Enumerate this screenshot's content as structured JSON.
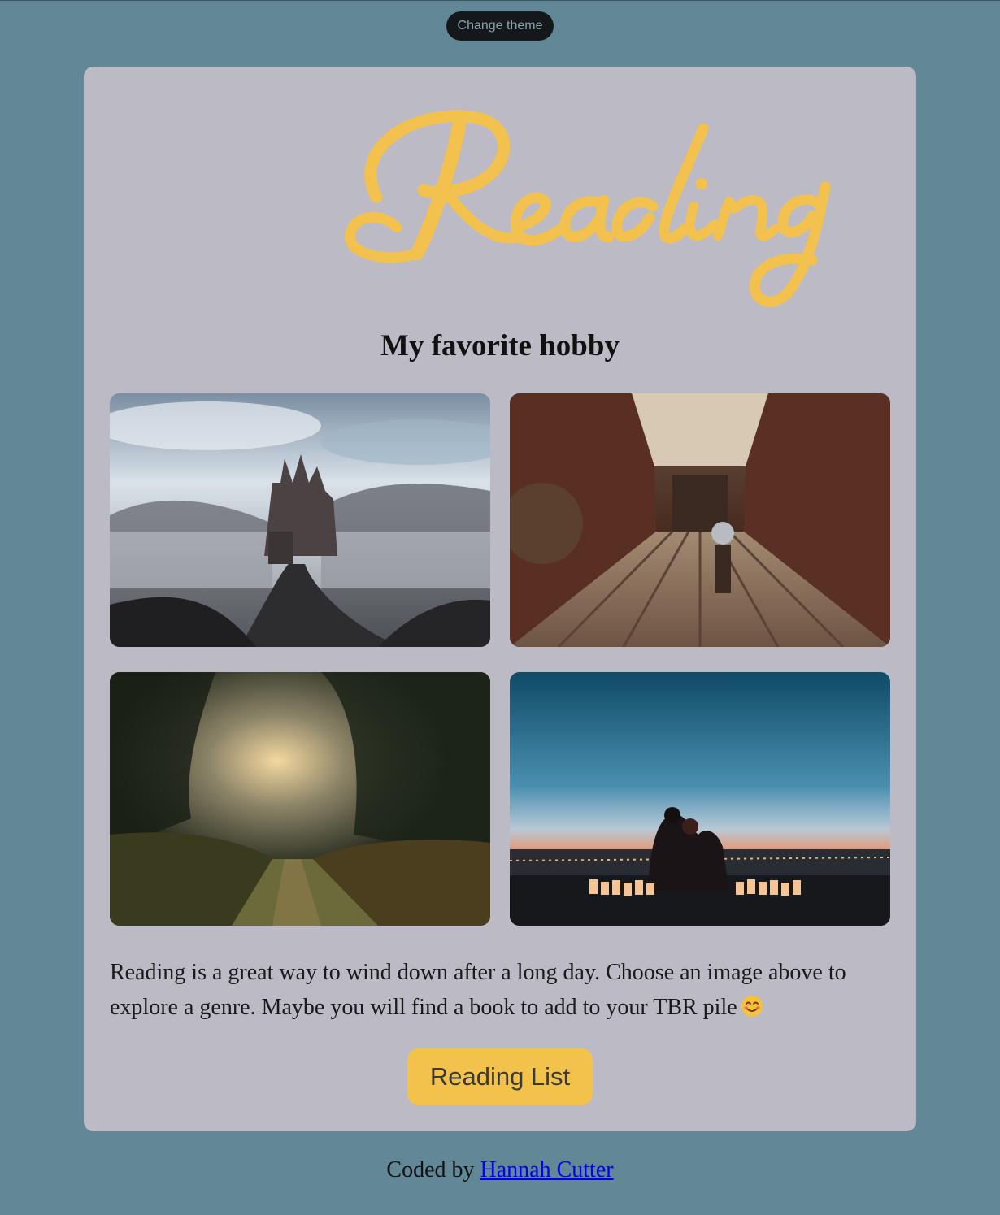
{
  "theme_button": {
    "label": "Change theme"
  },
  "header": {
    "logo_text": "Reading",
    "subtitle": "My favorite hobby"
  },
  "gallery": [
    {
      "name": "castle-in-fog"
    },
    {
      "name": "baroque-library"
    },
    {
      "name": "misty-forest-path"
    },
    {
      "name": "couple-at-sunset-with-candles"
    }
  ],
  "description": "Reading is a great way to wind down after a long day. Choose an image above to explore a genre. Maybe you will find a book to add to your TBR pile",
  "description_emoji": "smiling-face-emoji",
  "cta": {
    "label": "Reading List"
  },
  "footer": {
    "prefix": "Coded by",
    "author_link": "Hannah Cutter"
  },
  "colors": {
    "page_bg": "#628797",
    "card_bg": "#bcbbc5",
    "accent": "#f3c24b",
    "theme_button_bg": "#14181a"
  }
}
